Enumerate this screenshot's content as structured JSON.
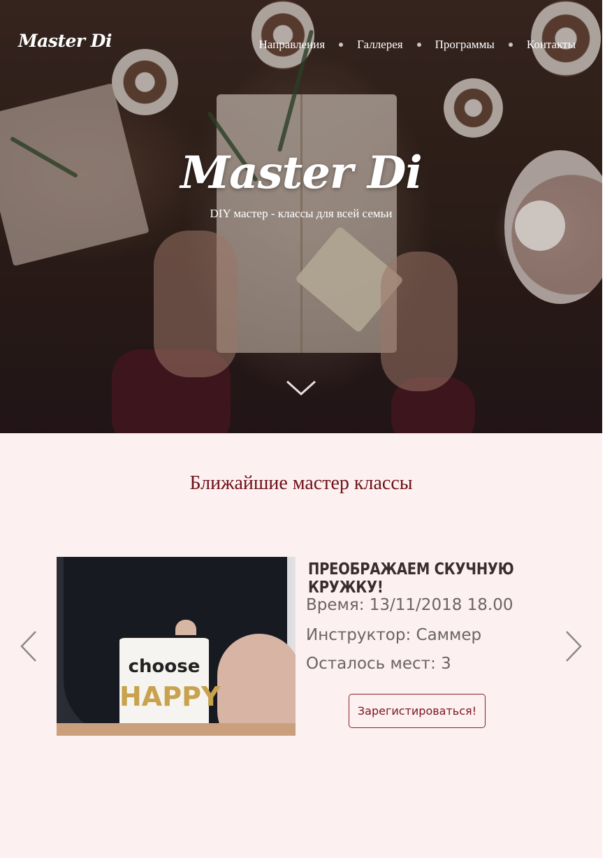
{
  "header": {
    "logo": "Master Di",
    "nav": [
      "Направления",
      "Галлерея",
      "Программы",
      "Контакты"
    ]
  },
  "hero": {
    "title": "Master Di",
    "subtitle": "DIY мастер - классы для всей семьи",
    "scroll_icon": "chevron-down-icon"
  },
  "classes": {
    "section_title": "Ближайшие мастер классы",
    "event": {
      "title": "ПРЕОБРАЖАЕМ СКУЧНУЮ КРУЖКУ!",
      "time": "Время: 13/11/2018 18.00",
      "instructor": "Инструктор: Саммер",
      "seats": "Осталось мест: 3",
      "button": "Зарегистироваться!",
      "image_text": {
        "line1": "choose",
        "line2": "HAPPY"
      }
    },
    "prev_icon": "chevron-left-icon",
    "next_icon": "chevron-right-icon"
  },
  "colors": {
    "accent": "#6e1019",
    "background": "#fdf0f0",
    "button_border": "#8b1f28"
  }
}
